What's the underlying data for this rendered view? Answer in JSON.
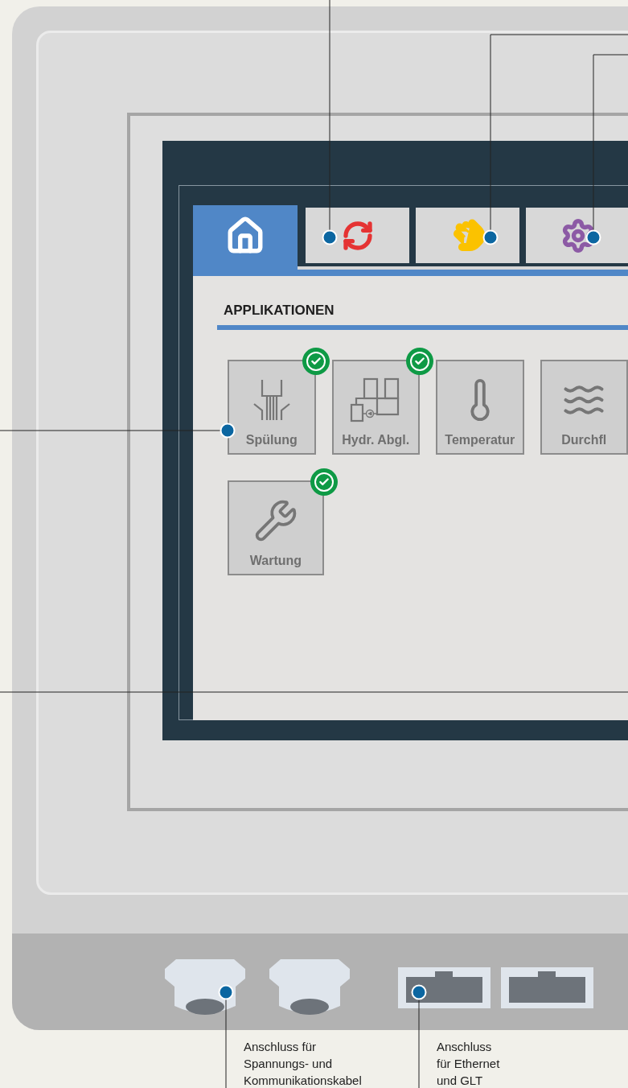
{
  "tabs": [
    {
      "kind": "home",
      "selected": true
    },
    {
      "kind": "sync",
      "selected": false
    },
    {
      "kind": "hand",
      "selected": false
    },
    {
      "kind": "gear",
      "selected": false
    }
  ],
  "section_title": "APPLIKATIONEN",
  "app_rows": [
    [
      {
        "kind": "flush",
        "label": "Spülung",
        "done": true
      },
      {
        "kind": "hydraulic",
        "label": "Hydr. Abgl.",
        "done": true
      },
      {
        "kind": "thermometer",
        "label": "Temperatur",
        "done": false
      },
      {
        "kind": "waves",
        "label": "Durchfl",
        "done": false
      }
    ],
    [
      {
        "kind": "wrench",
        "label": "Wartung",
        "done": true
      }
    ]
  ],
  "captions": [
    "Anschluss für\nSpannungs- und\nKommunikationskabel",
    "Anschluss\nfür Ethernet\nund GLT"
  ]
}
